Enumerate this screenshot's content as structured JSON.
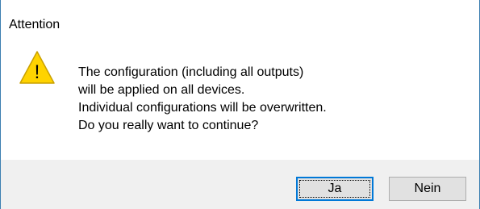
{
  "window": {
    "title": "Attention"
  },
  "message": {
    "lines": [
      "The configuration (including all outputs)",
      "will be applied on all devices.",
      "Individual configurations will be overwritten.",
      "Do you really want to continue?"
    ]
  },
  "icon": {
    "name": "warning-icon",
    "glyph": "!",
    "fill": "#ffd300",
    "stroke": "#c9a000"
  },
  "buttons": {
    "yes_label": "Ja",
    "no_label": "Nein"
  },
  "colors": {
    "frame": "#3c7fb1",
    "footer": "#f0f0f0",
    "default_button_border": "#0078d7"
  }
}
